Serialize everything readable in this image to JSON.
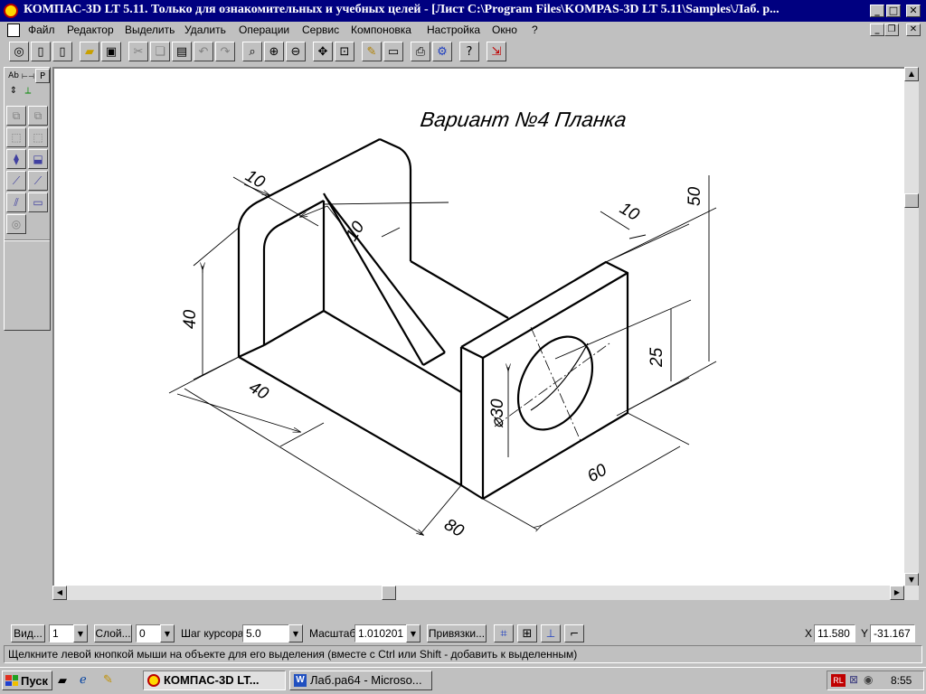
{
  "titlebar": {
    "title": "КОМПАС-3D LT 5.11. Только для ознакомительных и учебных целей - [Лист C:\\Program Files\\KOMPAS-3D LT 5.11\\Samples\\Лаб. р...",
    "minimize": "_",
    "maximize": "□",
    "close": "✕"
  },
  "menu": {
    "items": [
      "Файл",
      "Редактор",
      "Выделить",
      "Удалить",
      "Операции",
      "Сервис",
      "Компоновка",
      "Настройка",
      "Окно",
      "?"
    ]
  },
  "toolbar": {
    "icons": [
      "kompas-icon",
      "new-sheet-icon",
      "new-fragment-icon",
      "open-icon",
      "save-icon",
      "cut-icon",
      "copy-icon",
      "paste-icon",
      "undo-icon",
      "redo-icon",
      "zoom-window-icon",
      "zoom-in-icon",
      "zoom-out-icon",
      "pan-icon",
      "zoom-all-icon",
      "refresh-icon",
      "preview-icon",
      "print-icon",
      "settings-icon",
      "help-icon",
      "exit-icon"
    ]
  },
  "leftpanel": {
    "tabs": [
      "Ab",
      "⊢⊣",
      "P"
    ]
  },
  "drawing": {
    "title": "Вариант №4 Планка",
    "dimensions": [
      "10",
      "10",
      "10",
      "50",
      "40",
      "40",
      "25",
      "⌀30",
      "60",
      "80"
    ]
  },
  "parambar": {
    "view_button": "Вид...",
    "view_value": "1",
    "layer_button": "Слой...",
    "layer_value": "0",
    "step_label": "Шаг курсора",
    "step_value": "5.0",
    "scale_label": "Масштаб",
    "scale_value": "1.010201",
    "snaps_button": "Привязки...",
    "x_label": "X",
    "x_value": "11.580",
    "y_label": "Y",
    "y_value": "-31.167"
  },
  "status": {
    "text": "Щелкните левой кнопкой мыши на объекте для его выделения (вместе с Ctrl или Shift - добавить к выделенным)"
  },
  "taskbar": {
    "start": "Пуск",
    "tasks": [
      {
        "label": "КОМПАС-3D LT...",
        "active": true
      },
      {
        "label": "Лаб.ра64 - Microso...",
        "active": false
      }
    ],
    "tray_lang": "RL",
    "time": "8:55"
  },
  "colors": {
    "titlebar": "#000080",
    "face": "#c0c0c0",
    "canvas": "#ffffff"
  }
}
